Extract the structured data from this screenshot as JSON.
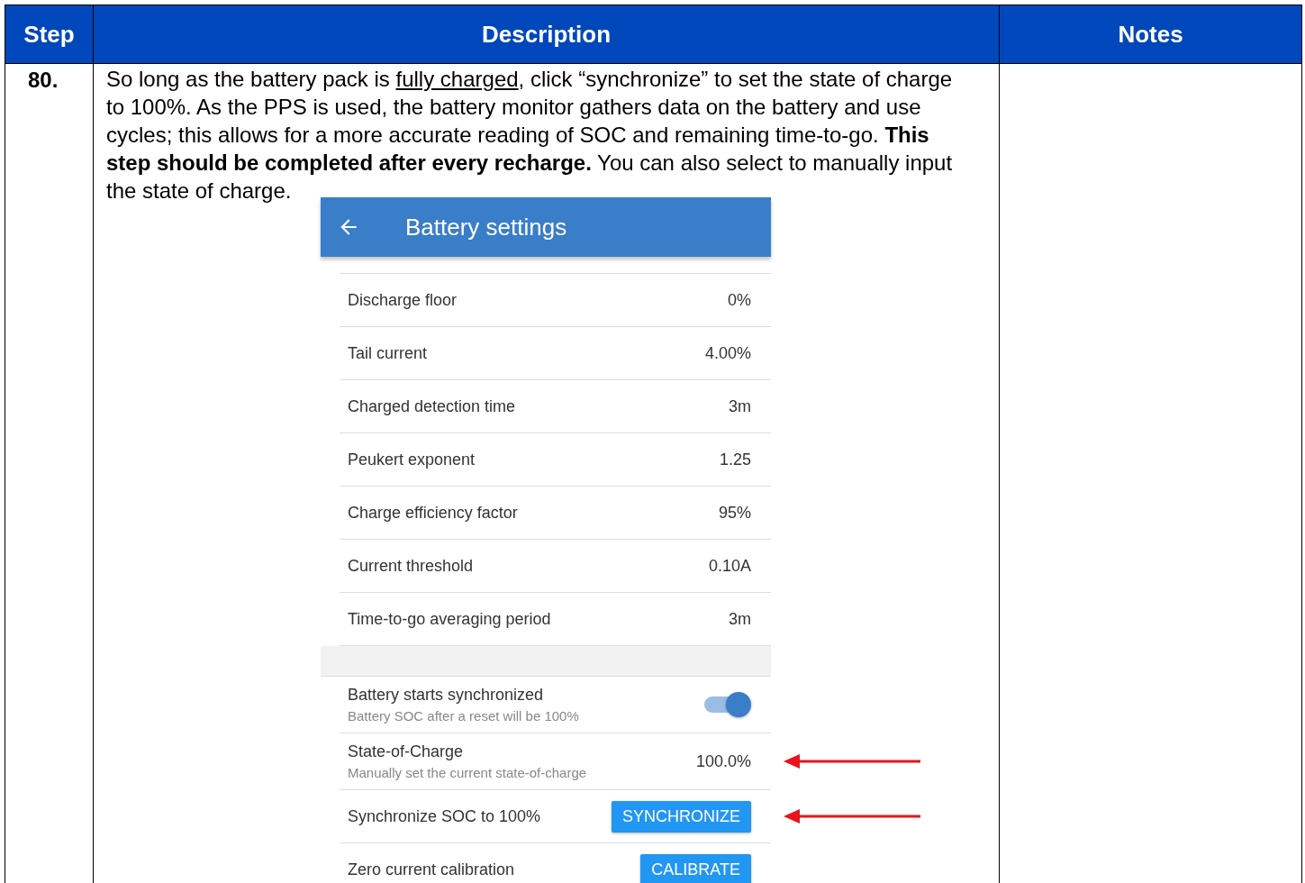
{
  "table": {
    "columns": [
      "Step",
      "Description",
      "Notes"
    ],
    "rows": [
      {
        "step": "80.",
        "description": [
          {
            "text": "So long as the battery pack is ",
            "kind": "plain"
          },
          {
            "text": "fully charged",
            "kind": "link"
          },
          {
            "text": ", click “synchronize” to set the state of charge to 100%. As the PPS is used, the battery monitor gathers data on the battery and use cycles; this allows for a more accurate reading of SOC and remaining time-to-go. ",
            "kind": "plain"
          },
          {
            "text": "This step should be completed after every recharge.",
            "kind": "emphasis"
          },
          {
            "text": " You can also select to manually input the state of charge.",
            "kind": "plain"
          }
        ],
        "screen": {
          "title": "Battery settings",
          "items": [
            {
              "kind": "value",
              "label": "Discharge floor",
              "value": "0%",
              "pointed": false
            },
            {
              "kind": "value",
              "label": "Tail current",
              "value": "4.00%",
              "pointed": false
            },
            {
              "kind": "value",
              "label": "Charged detection time",
              "value": "3m",
              "pointed": false
            },
            {
              "kind": "value",
              "label": "Peukert exponent",
              "value": "1.25",
              "pointed": false
            },
            {
              "kind": "value",
              "label": "Charge efficiency factor",
              "value": "95%",
              "pointed": false
            },
            {
              "kind": "value",
              "label": "Current threshold",
              "value": "0.10A",
              "pointed": false
            },
            {
              "kind": "value",
              "label": "Time-to-go averaging period",
              "value": "3m",
              "pointed": false
            },
            {
              "kind": "spacer"
            },
            {
              "kind": "toggle",
              "label": "Battery starts synchronized",
              "sublabel": "Battery SOC after a reset will be 100%",
              "on": true,
              "pointed": false
            },
            {
              "kind": "value",
              "label": "State-of-Charge",
              "sublabel": "Manually set the current state-of-charge",
              "value": "100.0%",
              "pointed": true
            },
            {
              "kind": "button",
              "label": "Synchronize SOC to 100%",
              "button": "SYNCHRONIZE",
              "pointed": true
            },
            {
              "kind": "button",
              "label": "Zero current calibration",
              "button": "CALIBRATE",
              "pointed": false
            }
          ]
        }
      }
    ]
  }
}
